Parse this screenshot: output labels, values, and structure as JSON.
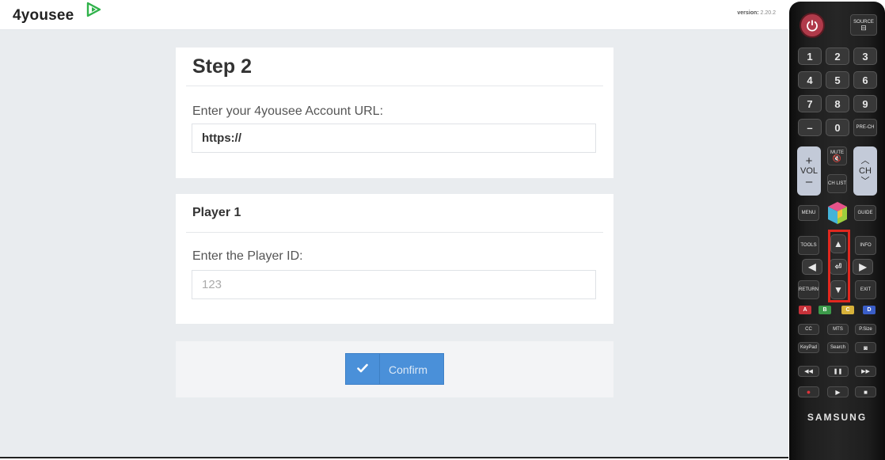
{
  "header": {
    "logo_text": "4yousee",
    "logo_mark": "play-arrow-logo-icon",
    "version_label": "version:",
    "version_value": "2.20.2"
  },
  "step": {
    "title": "Step 2",
    "url_label": "Enter your 4yousee Account URL:",
    "url_value": "https://"
  },
  "player": {
    "title": "Player 1",
    "id_label": "Enter the Player ID:",
    "id_placeholder": "123"
  },
  "actions": {
    "confirm_label": "Confirm",
    "confirm_icon": "checkmark-icon"
  },
  "remote": {
    "source": "SOURCE",
    "digits": [
      "1",
      "2",
      "3",
      "4",
      "5",
      "6",
      "7",
      "8",
      "9"
    ],
    "dash": "–",
    "zero": "0",
    "prech": "PRE-CH",
    "vol_plus": "+",
    "vol": "VOL",
    "vol_minus": "–",
    "mute": "MUTE",
    "chlist": "CH LIST",
    "ch": "CH",
    "menu": "MENU",
    "guide": "GUIDE",
    "tools": "TOOLS",
    "info": "INFO",
    "return": "RETURN",
    "exit": "EXIT",
    "color_keys": [
      "A",
      "B",
      "C",
      "D"
    ],
    "cc": "CC",
    "mts": "MTS",
    "psize": "P.Size",
    "keypad": "KeyPad",
    "search": "Search",
    "brand": "SAMSUNG",
    "colors": {
      "a": "#c8323a",
      "b": "#3c9a4a",
      "c": "#d8b23a",
      "d": "#3a5ec8"
    }
  }
}
